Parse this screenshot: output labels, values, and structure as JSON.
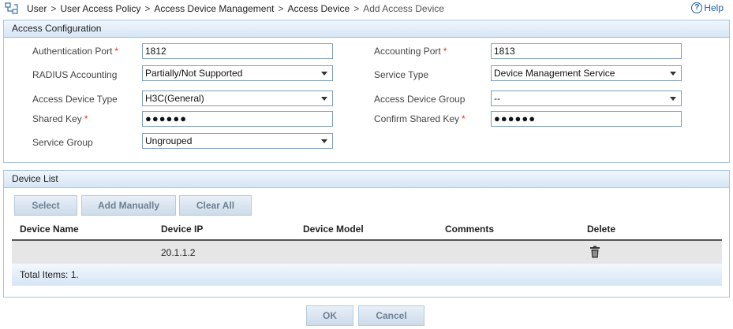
{
  "breadcrumb": {
    "items": [
      "User",
      "User Access Policy",
      "Access Device Management",
      "Access Device",
      "Add Access Device"
    ],
    "separator": ">",
    "icon": "network-device-icon"
  },
  "help": {
    "label": "Help",
    "icon": "question-circle-icon"
  },
  "access_config": {
    "title": "Access Configuration",
    "fields": {
      "auth_port": {
        "label": "Authentication Port",
        "required_mark": "*",
        "value": "1812"
      },
      "accounting_port": {
        "label": "Accounting Port",
        "required_mark": "*",
        "value": "1813"
      },
      "radius_accounting": {
        "label": "RADIUS Accounting",
        "value": "Partially/Not Supported"
      },
      "service_type": {
        "label": "Service Type",
        "value": "Device Management Service"
      },
      "access_device_type": {
        "label": "Access Device Type",
        "value": "H3C(General)"
      },
      "access_device_group": {
        "label": "Access Device Group",
        "value": "--"
      },
      "shared_key": {
        "label": "Shared Key",
        "required_mark": "*",
        "value": "●●●●●●"
      },
      "confirm_shared_key": {
        "label": "Confirm Shared Key",
        "required_mark": "*",
        "value": "●●●●●●"
      },
      "service_group": {
        "label": "Service Group",
        "value": "Ungrouped"
      }
    }
  },
  "device_list": {
    "title": "Device List",
    "buttons": {
      "select": "Select",
      "add_manually": "Add Manually",
      "clear_all": "Clear All"
    },
    "columns": [
      "Device Name",
      "Device IP",
      "Device Model",
      "Comments",
      "Delete"
    ],
    "rows": [
      {
        "name": "",
        "ip": "20.1.1.2",
        "model": "",
        "comments": "",
        "delete_icon": "trash-icon"
      }
    ],
    "total": "Total Items: 1."
  },
  "actions": {
    "ok": "OK",
    "cancel": "Cancel"
  },
  "colors": {
    "panel_border": "#a8c4e2",
    "required": "#e03030",
    "help": "#1d5fa8"
  }
}
